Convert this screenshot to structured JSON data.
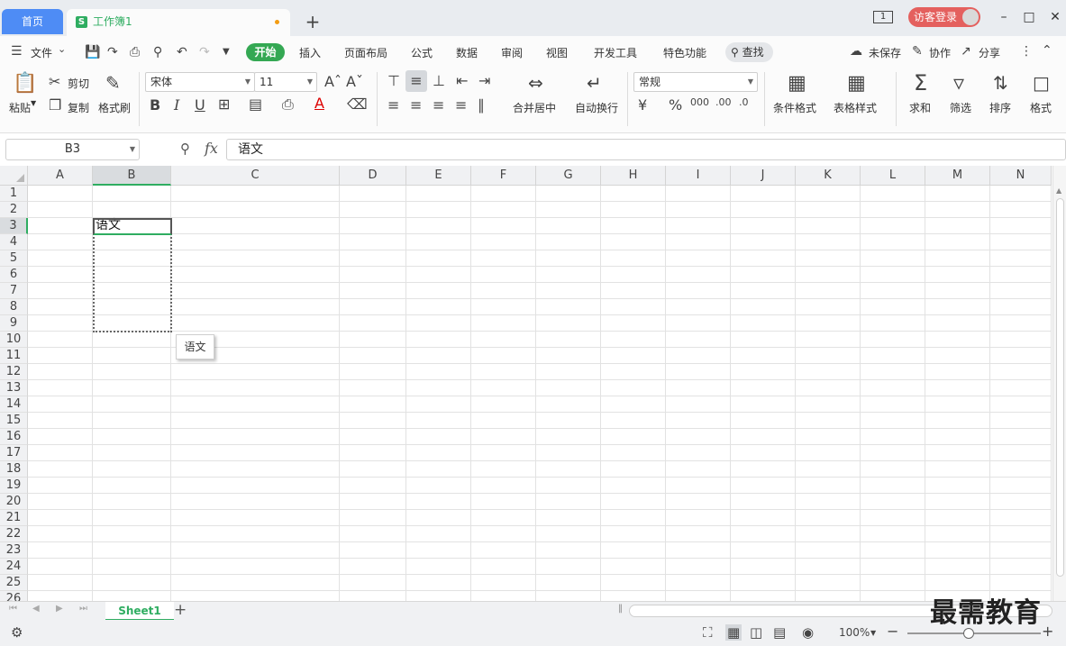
{
  "tabs": {
    "home": "首页",
    "doc": "工作簿1",
    "new_tab": "+"
  },
  "titlebar": {
    "badge": "1",
    "login": "访客登录"
  },
  "menu": {
    "file": "文件",
    "items": [
      "开始",
      "插入",
      "页面布局",
      "公式",
      "数据",
      "审阅",
      "视图",
      "开发工具",
      "特色功能"
    ],
    "search": "查找",
    "unsaved": "未保存",
    "collab": "协作",
    "share": "分享"
  },
  "toolbar": {
    "paste": "粘贴",
    "cut": "剪切",
    "copy": "复制",
    "format_painter": "格式刷",
    "font_name": "宋体",
    "font_size": "11",
    "merge_center": "合并居中",
    "wrap_text": "自动换行",
    "number_format": "常规",
    "cond_format": "条件格式",
    "table_style": "表格样式",
    "sum": "求和",
    "filter": "筛选",
    "sort": "排序",
    "format": "格式"
  },
  "formula": {
    "cell_ref": "B3",
    "fx": "fx",
    "content": "语文"
  },
  "grid": {
    "columns": [
      "A",
      "B",
      "C",
      "D",
      "E",
      "F",
      "G",
      "H",
      "I",
      "J",
      "K",
      "L",
      "M",
      "N"
    ],
    "rows": [
      "1",
      "2",
      "3",
      "4",
      "5",
      "6",
      "7",
      "8",
      "9",
      "10",
      "11",
      "12",
      "13",
      "14",
      "15",
      "16",
      "17",
      "18",
      "19",
      "20",
      "21",
      "22",
      "23",
      "24",
      "25",
      "26"
    ],
    "cell_b3": "语文",
    "autocomplete": "语文"
  },
  "sheets": {
    "active": "Sheet1",
    "add": "+"
  },
  "status": {
    "zoom": "100%"
  },
  "watermark": "最需教育"
}
